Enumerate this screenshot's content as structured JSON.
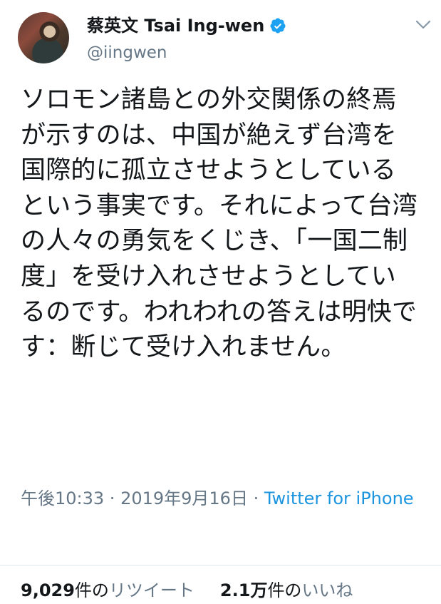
{
  "author": {
    "display_name": "蔡英文 Tsai Ing-wen",
    "handle": "@iingwen",
    "avatar_icon": "profile-photo",
    "verified_icon": "verified-badge-icon",
    "verified_color": "#1da1f2"
  },
  "menu_icon": "chevron-down-icon",
  "tweet": {
    "text": "ソロモン諸島との外交関係の終焉が示すのは、中国が絶えず台湾を国際的に孤立させようとしているという事実です。それによって台湾の人々の勇気をくじき、「一国二制度」を受け入れさせようとしているのです。われわれの答えは明快です：断じて受け入れません。"
  },
  "meta": {
    "time": "午後10:33",
    "separator1": " · ",
    "date": "2019年9月16日",
    "separator2": " · ",
    "source": "Twitter for iPhone"
  },
  "stats": {
    "retweets": {
      "count": "9,029",
      "unit": "件の",
      "label": "リツイート"
    },
    "likes": {
      "count": "2.1万",
      "unit": "件の",
      "label": "いいね"
    }
  },
  "colors": {
    "text": "#14171a",
    "secondary": "#657786",
    "link": "#1b95e0",
    "divider": "#e1e8ed"
  }
}
